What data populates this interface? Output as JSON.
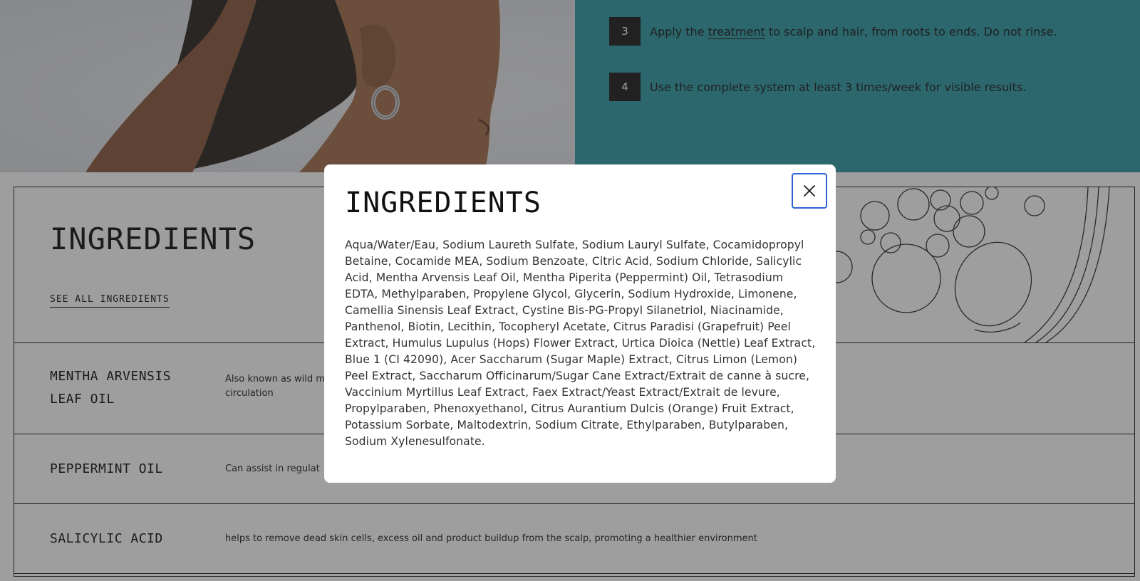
{
  "steps": [
    {
      "number": "3",
      "text_before": "Apply the ",
      "link": "treatment",
      "text_after": " to scalp and hair, from roots to ends. Do not rinse."
    },
    {
      "number": "4",
      "text": "Use the complete system at least 3 times/week for visible results."
    }
  ],
  "ingredients_section": {
    "title": "INGREDIENTS",
    "see_all_label": "SEE ALL INGREDIENTS",
    "rows": [
      {
        "name_line1": "MENTHA ARVENSIS",
        "name_line2": "LEAF OIL",
        "desc_line1": "Also known as wild m",
        "desc_line2": "circulation"
      },
      {
        "name_line1": "PEPPERMINT OIL",
        "desc_line1": "Can assist in regulat"
      },
      {
        "name_line1": "SALICYLIC ACID",
        "desc_line1": "helps to remove dead skin cells, excess oil and product buildup from the scalp, promoting a healthier environment"
      }
    ]
  },
  "modal": {
    "title": "INGREDIENTS",
    "body": "Aqua/Water/Eau, Sodium Laureth Sulfate, Sodium Lauryl Sulfate, Cocamidopropyl Betaine, Cocamide MEA, Sodium Benzoate, Citric Acid, Sodium Chloride, Salicylic Acid, Mentha Arvensis Leaf Oil, Mentha Piperita (Peppermint) Oil, Tetrasodium EDTA, Methylparaben, Propylene Glycol, Glycerin, Sodium Hydroxide, Limonene, Camellia Sinensis Leaf Extract, Cystine Bis-PG-Propyl Silanetriol, Niacinamide, Panthenol, Biotin, Lecithin, Tocopheryl Acetate, Citrus Paradisi (Grapefruit) Peel Extract, Humulus Lupulus (Hops) Flower Extract, Urtica Dioica (Nettle) Leaf Extract, Blue 1 (CI 42090), Acer Saccharum (Sugar Maple) Extract, Citrus Limon (Lemon) Peel Extract, Saccharum Officinarum/Sugar Cane Extract/Extrait de canne à sucre, Vaccinium Myrtillus Leaf Extract, Faex Extract/Yeast Extract/Extrait de levure, Propylparaben, Phenoxyethanol, Citrus Aurantium Dulcis (Orange) Fruit Extract, Potassium Sorbate, Maltodextrin, Sodium Citrate, Ethylparaben, Butylparaben, Sodium Xylenesulfonate.",
    "close_icon": "close-icon"
  },
  "colors": {
    "steps_panel": "#2e9ba6",
    "step_badge": "#1d1d1d",
    "close_focus": "#2f62d6",
    "overlay": "rgba(40,40,40,0.45)"
  }
}
